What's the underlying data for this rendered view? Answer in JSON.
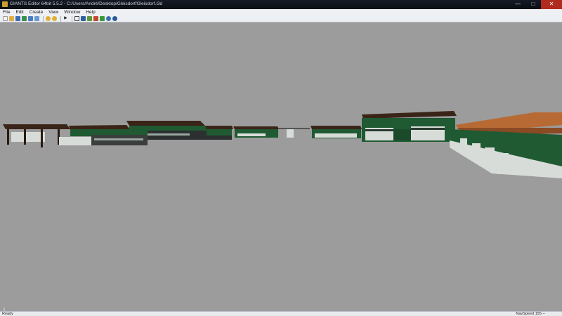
{
  "window": {
    "title": "GIANTS Editor 64bit 5.5.2 - C:/Users/André/Desktop/Gleisdorf/Gleisdorf.i3d",
    "minimize_glyph": "—",
    "maximize_glyph": "□",
    "close_glyph": "✕"
  },
  "menu": {
    "items": [
      "File",
      "Edit",
      "Create",
      "View",
      "Window",
      "Help"
    ]
  },
  "toolbar": {
    "icons": [
      {
        "name": "new-file-icon",
        "color": "#f4f4f4"
      },
      {
        "name": "open-file-icon",
        "color": "#e0b040"
      },
      {
        "name": "save-icon",
        "color": "#3b6fb5"
      },
      {
        "name": "save-copy-icon",
        "color": "#3b8f4a"
      },
      {
        "name": "export-icon",
        "color": "#4a7ac0"
      },
      {
        "name": "import-icon",
        "color": "#6a9ad0"
      },
      {
        "name": "undo-icon",
        "color": "#e0b030"
      },
      {
        "name": "redo-icon",
        "color": "#e0b030"
      },
      {
        "name": "play-icon",
        "color": "#222222"
      },
      {
        "name": "select-icon",
        "color": "#444444"
      },
      {
        "name": "move-icon",
        "color": "#3060a0"
      },
      {
        "name": "terrain-icon",
        "color": "#5a9a3a"
      },
      {
        "name": "paint-icon",
        "color": "#c04a2a"
      },
      {
        "name": "foliage-icon",
        "color": "#3a9a3a"
      },
      {
        "name": "settings-icon",
        "color": "#3a70b0"
      },
      {
        "name": "refresh-icon",
        "color": "#2a5a9a"
      }
    ]
  },
  "status": {
    "left": "Ready",
    "right": "NavSpeed 155 --"
  },
  "colors": {
    "viewport_bg": "#9c9c9c",
    "roof_dark": "#3a2418",
    "roof_orange": "#b86a34",
    "wall_green": "#1f5a32",
    "wall_white": "#d8dcd8"
  }
}
